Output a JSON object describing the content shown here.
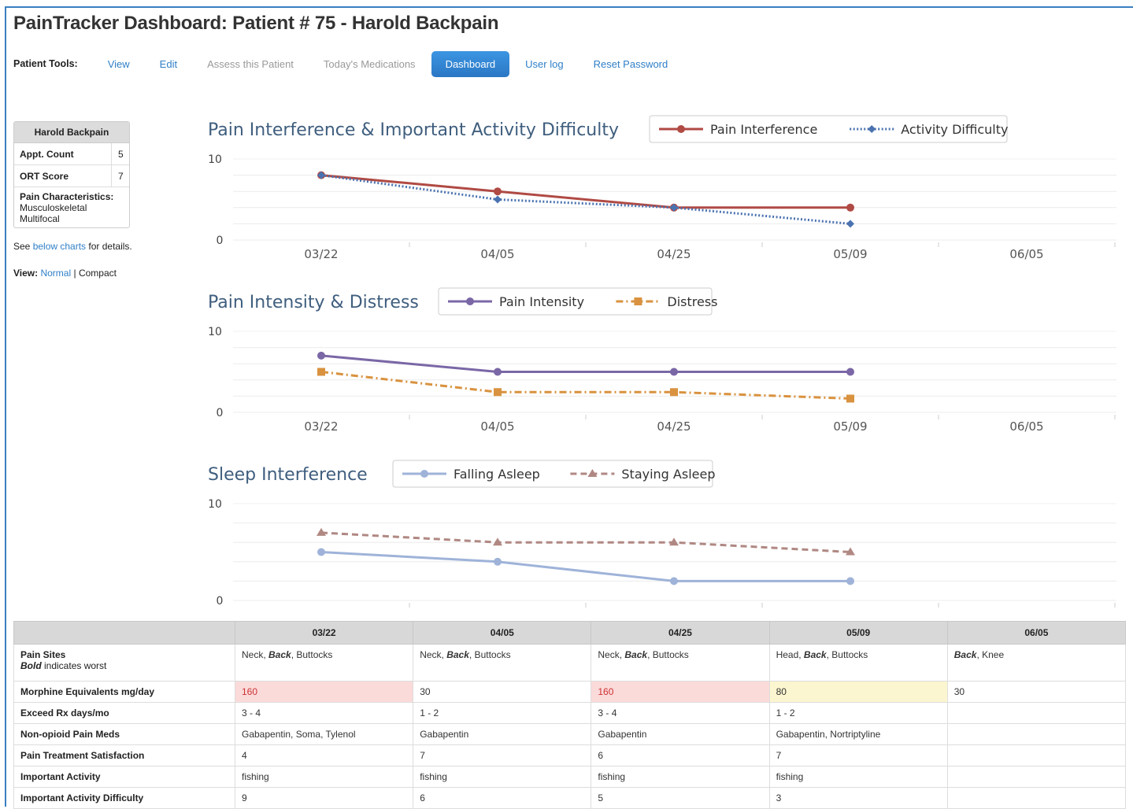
{
  "title": "PainTracker Dashboard: Patient # 75 - Harold Backpain",
  "tools": {
    "label": "Patient Tools:",
    "items": [
      "View",
      "Edit",
      "Assess this Patient",
      "Today's Medications",
      "Dashboard",
      "User log",
      "Reset Password"
    ]
  },
  "summary": {
    "name": "Harold Backpain",
    "appt_label": "Appt. Count",
    "appt_value": "5",
    "ort_label": "ORT Score",
    "ort_value": "7",
    "pc_label": "Pain Characteristics:",
    "pc_values": [
      "Musculoskeletal",
      "Multifocal"
    ]
  },
  "note": {
    "prefix": "See ",
    "link": "below charts",
    "suffix": " for details."
  },
  "view": {
    "label": "View:",
    "normal": "Normal",
    "sep": " | ",
    "compact": "Compact"
  },
  "chart_data": [
    {
      "type": "line",
      "title": "Pain Interference & Important Activity Difficulty",
      "categories": [
        "03/22",
        "04/05",
        "04/25",
        "05/09",
        "06/05"
      ],
      "ylim": [
        0,
        10
      ],
      "series": [
        {
          "name": "Pain Interference",
          "values": [
            8,
            6,
            4,
            4
          ],
          "color": "#b04a44",
          "style": "solid",
          "marker": "circle"
        },
        {
          "name": "Activity Difficulty",
          "values": [
            8,
            5,
            4,
            2
          ],
          "color": "#4a72b0",
          "style": "dotted",
          "marker": "diamond"
        }
      ]
    },
    {
      "type": "line",
      "title": "Pain Intensity & Distress",
      "categories": [
        "03/22",
        "04/05",
        "04/25",
        "05/09",
        "06/05"
      ],
      "ylim": [
        0,
        10
      ],
      "series": [
        {
          "name": "Pain Intensity",
          "values": [
            7,
            5,
            5,
            5
          ],
          "color": "#7a67a6",
          "style": "solid",
          "marker": "circle"
        },
        {
          "name": "Distress",
          "values": [
            5,
            2.5,
            2.5,
            1.7
          ],
          "color": "#d9923f",
          "style": "dashdot",
          "marker": "square"
        }
      ]
    },
    {
      "type": "line",
      "title": "Sleep Interference",
      "categories": [
        "03/22",
        "04/05",
        "04/25",
        "05/09",
        "06/05"
      ],
      "ylim": [
        0,
        10
      ],
      "series": [
        {
          "name": "Falling Asleep",
          "values": [
            5,
            4,
            2,
            2
          ],
          "color": "#9fb3d9",
          "style": "solid",
          "marker": "circle"
        },
        {
          "name": "Staying Asleep",
          "values": [
            7,
            6,
            6,
            5
          ],
          "color": "#b08883",
          "style": "dashed",
          "marker": "triangle"
        }
      ]
    }
  ],
  "table": {
    "dates": [
      "03/22",
      "04/05",
      "04/25",
      "05/09",
      "06/05"
    ],
    "rows": [
      {
        "label": "Pain Sites",
        "sublabel_bold": "Bold",
        "sublabel_rest": " indicates worst",
        "cells": [
          [
            "Neck, ",
            "Back",
            ", Buttocks"
          ],
          [
            "Neck, ",
            "Back",
            ", Buttocks"
          ],
          [
            "Neck, ",
            "Back",
            ", Buttocks"
          ],
          [
            "Head, ",
            "Back",
            ", Buttocks"
          ],
          [
            "",
            "Back",
            ", Knee"
          ]
        ]
      },
      {
        "label": "Morphine Equivalents mg/day",
        "cells": [
          "160",
          "30",
          "160",
          "80",
          "30"
        ],
        "highlight": [
          "red",
          "",
          "red",
          "yellow",
          ""
        ]
      },
      {
        "label": "Exceed Rx days/mo",
        "cells": [
          "3 - 4",
          "1 - 2",
          "3 - 4",
          "1 - 2",
          ""
        ]
      },
      {
        "label": "Non-opioid Pain Meds",
        "cells": [
          "Gabapentin, Soma, Tylenol",
          "Gabapentin",
          "Gabapentin",
          "Gabapentin, Nortriptyline",
          ""
        ]
      },
      {
        "label": "Pain Treatment Satisfaction",
        "cells": [
          "4",
          "7",
          "6",
          "7",
          ""
        ]
      },
      {
        "label": "Important Activity",
        "cells": [
          "fishing",
          "fishing",
          "fishing",
          "fishing",
          ""
        ]
      },
      {
        "label": "Important Activity Difficulty",
        "cells": [
          "9",
          "6",
          "5",
          "3",
          ""
        ]
      }
    ]
  }
}
